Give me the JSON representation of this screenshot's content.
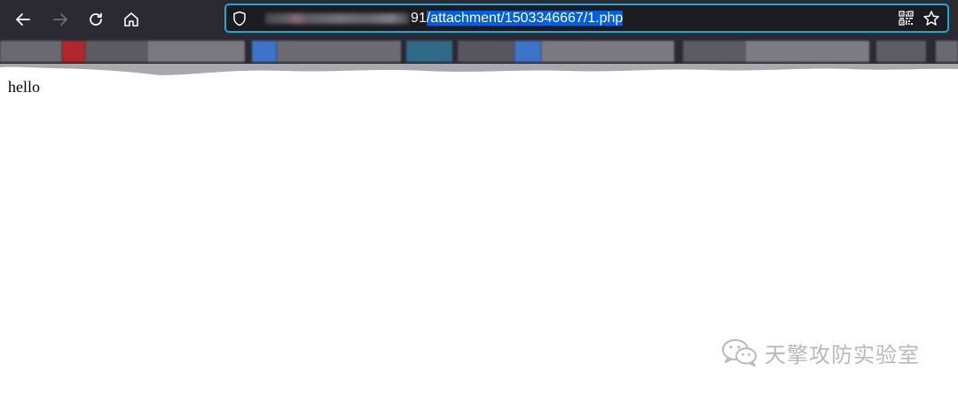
{
  "toolbar": {
    "url": {
      "host_port_suffix": "91",
      "path_selected": "/attachment/1503346667/1.php"
    }
  },
  "page": {
    "body_text": "hello"
  },
  "watermark": {
    "text": "天擎攻防实验室"
  },
  "icons": {
    "back": "arrow-left-icon",
    "forward": "arrow-right-icon",
    "reload": "reload-icon",
    "home": "home-icon",
    "security": "shield-icon",
    "qr": "qr-code-icon",
    "bookmark": "star-icon",
    "watermark_logo": "wechat-icon"
  },
  "colors": {
    "toolbar_bg": "#2b2a33",
    "urlbar_bg": "#1c1b22",
    "urlbar_focus_border": "#1ea8d4",
    "selection_bg": "#0060df",
    "forward_disabled": "#6e6d75",
    "watermark": "#b9b9b9"
  }
}
